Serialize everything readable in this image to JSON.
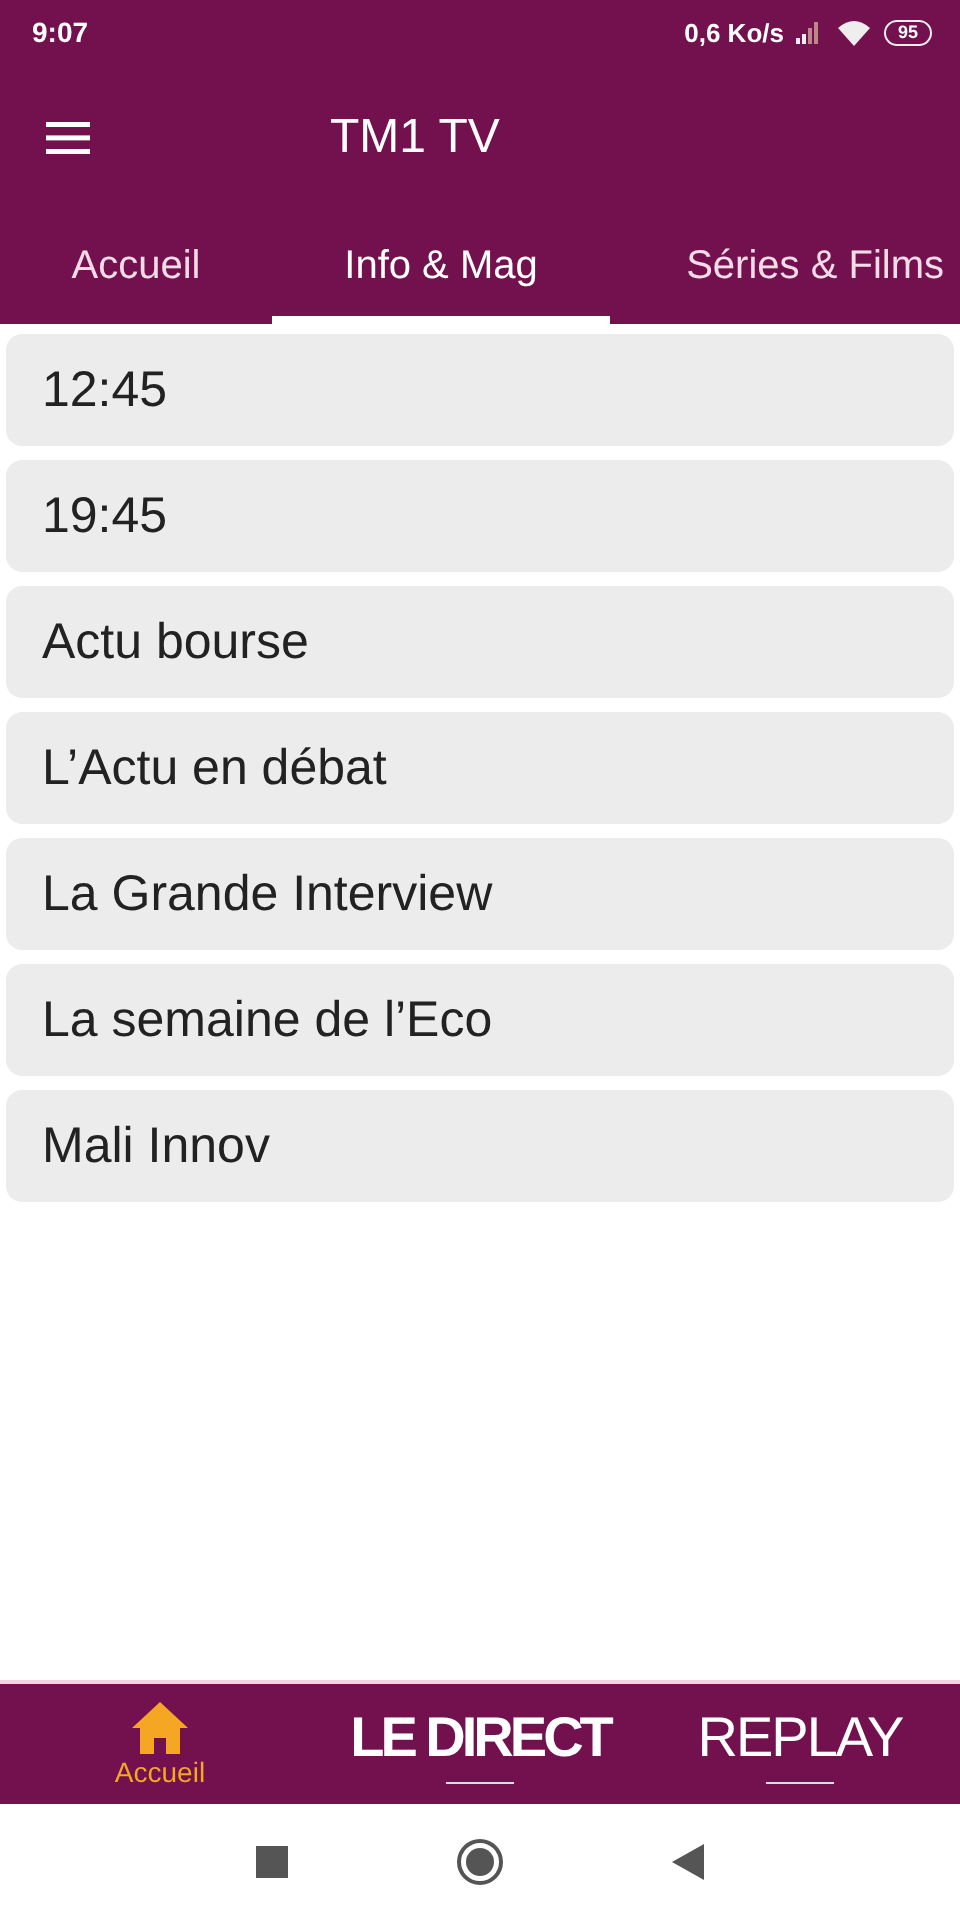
{
  "status_bar": {
    "time": "9:07",
    "network_speed": "0,6 Ko/s",
    "battery": "95"
  },
  "toolbar": {
    "title": "TM1 TV"
  },
  "tabs": [
    {
      "label": "Accueil",
      "selected": false
    },
    {
      "label": "Info & Mag",
      "selected": true
    },
    {
      "label": "Séries & Films",
      "selected": false
    }
  ],
  "items": [
    "12:45",
    "19:45",
    "Actu bourse",
    "L’Actu en débat",
    "La Grande Interview",
    "La semaine de l’Eco",
    "Mali Innov"
  ],
  "bottom_nav": [
    {
      "label": "Accueil",
      "kind": "home",
      "selected": true
    },
    {
      "label": "LE DIRECT",
      "kind": "bold",
      "selected": false
    },
    {
      "label": "REPLAY",
      "kind": "light",
      "selected": false
    }
  ]
}
